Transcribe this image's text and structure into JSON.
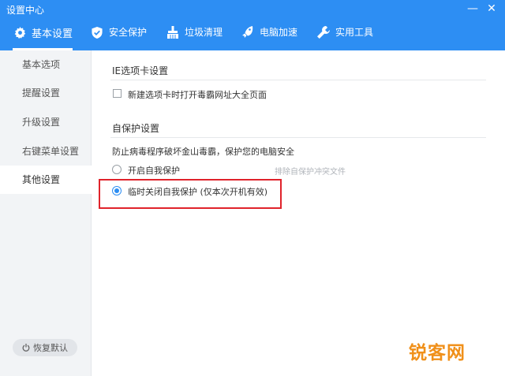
{
  "window": {
    "title": "设置中心",
    "minimize": "—",
    "close": "✕"
  },
  "tabs": [
    {
      "label": "基本设置",
      "icon": "gear-icon",
      "active": true
    },
    {
      "label": "安全保护",
      "icon": "shield-icon"
    },
    {
      "label": "垃圾清理",
      "icon": "broom-icon"
    },
    {
      "label": "电脑加速",
      "icon": "rocket-icon"
    },
    {
      "label": "实用工具",
      "icon": "wrench-icon"
    }
  ],
  "sidebar": {
    "items": [
      "基本选项",
      "提醒设置",
      "升级设置",
      "右键菜单设置",
      "其他设置"
    ],
    "active_index": 4,
    "restore_label": "恢复默认"
  },
  "ie_section": {
    "title": "IE选项卡设置",
    "checkbox_label": "新建选项卡时打开毒霸网址大全页面"
  },
  "self_protect": {
    "title": "自保护设置",
    "description": "防止病毒程序破坏金山毒霸，保护您的电脑安全",
    "option_on": "开启自我保护",
    "exclude_link": "排除自保护冲突文件",
    "option_off": "临时关闭自我保护 (仅本次开机有效)"
  },
  "watermark": "锐客网",
  "colors": {
    "accent": "#2d8ef3",
    "highlight": "#e0232b",
    "watermark": "#f0901a"
  }
}
